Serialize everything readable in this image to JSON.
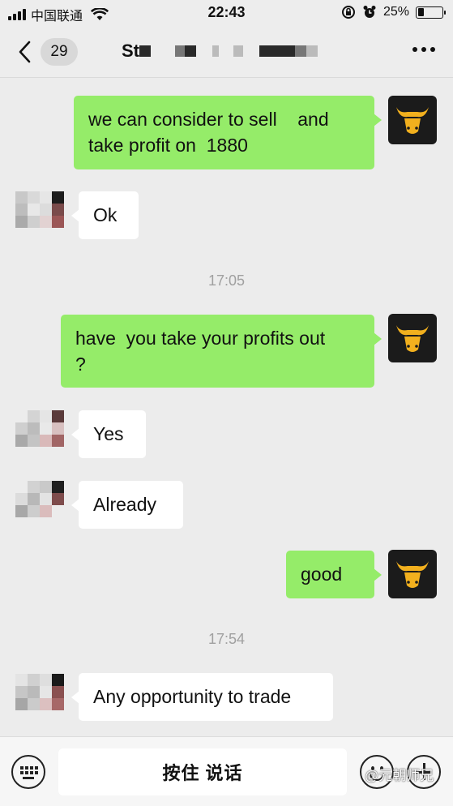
{
  "status_bar": {
    "carrier": "中国联通",
    "time": "22:43",
    "battery_percent": "25%",
    "battery_level": 0.25
  },
  "nav": {
    "unread_count": "29",
    "title_visible": "St"
  },
  "messages": [
    {
      "from": "me",
      "lines": [
        "we can consider to sell    and",
        "take profit on  1880"
      ]
    },
    {
      "from": "other",
      "text": "Ok"
    },
    {
      "timestamp": "17:05"
    },
    {
      "from": "me",
      "lines": [
        "have  you take your profits out",
        "?"
      ]
    },
    {
      "from": "other",
      "text": "Yes"
    },
    {
      "from": "other",
      "text": "Already"
    },
    {
      "from": "me",
      "text": "good"
    },
    {
      "timestamp": "17:54"
    },
    {
      "from": "other",
      "text": "Any opportunity to trade"
    }
  ],
  "input_bar": {
    "hold_to_talk_label": "按住 说话"
  },
  "watermark": "@元朝师兄",
  "colors": {
    "outgoing_bubble": "#95ec69",
    "incoming_bubble": "#ffffff",
    "background": "#ececec",
    "avatar_gold": "#f2b01e"
  },
  "icons": [
    "signal-icon",
    "wifi-icon",
    "lock-rotation-icon",
    "alarm-icon",
    "battery-icon",
    "back-chevron-icon",
    "more-icon",
    "bull-logo-avatar",
    "keyboard-voice-icon",
    "emoji-icon",
    "plus-icon"
  ]
}
